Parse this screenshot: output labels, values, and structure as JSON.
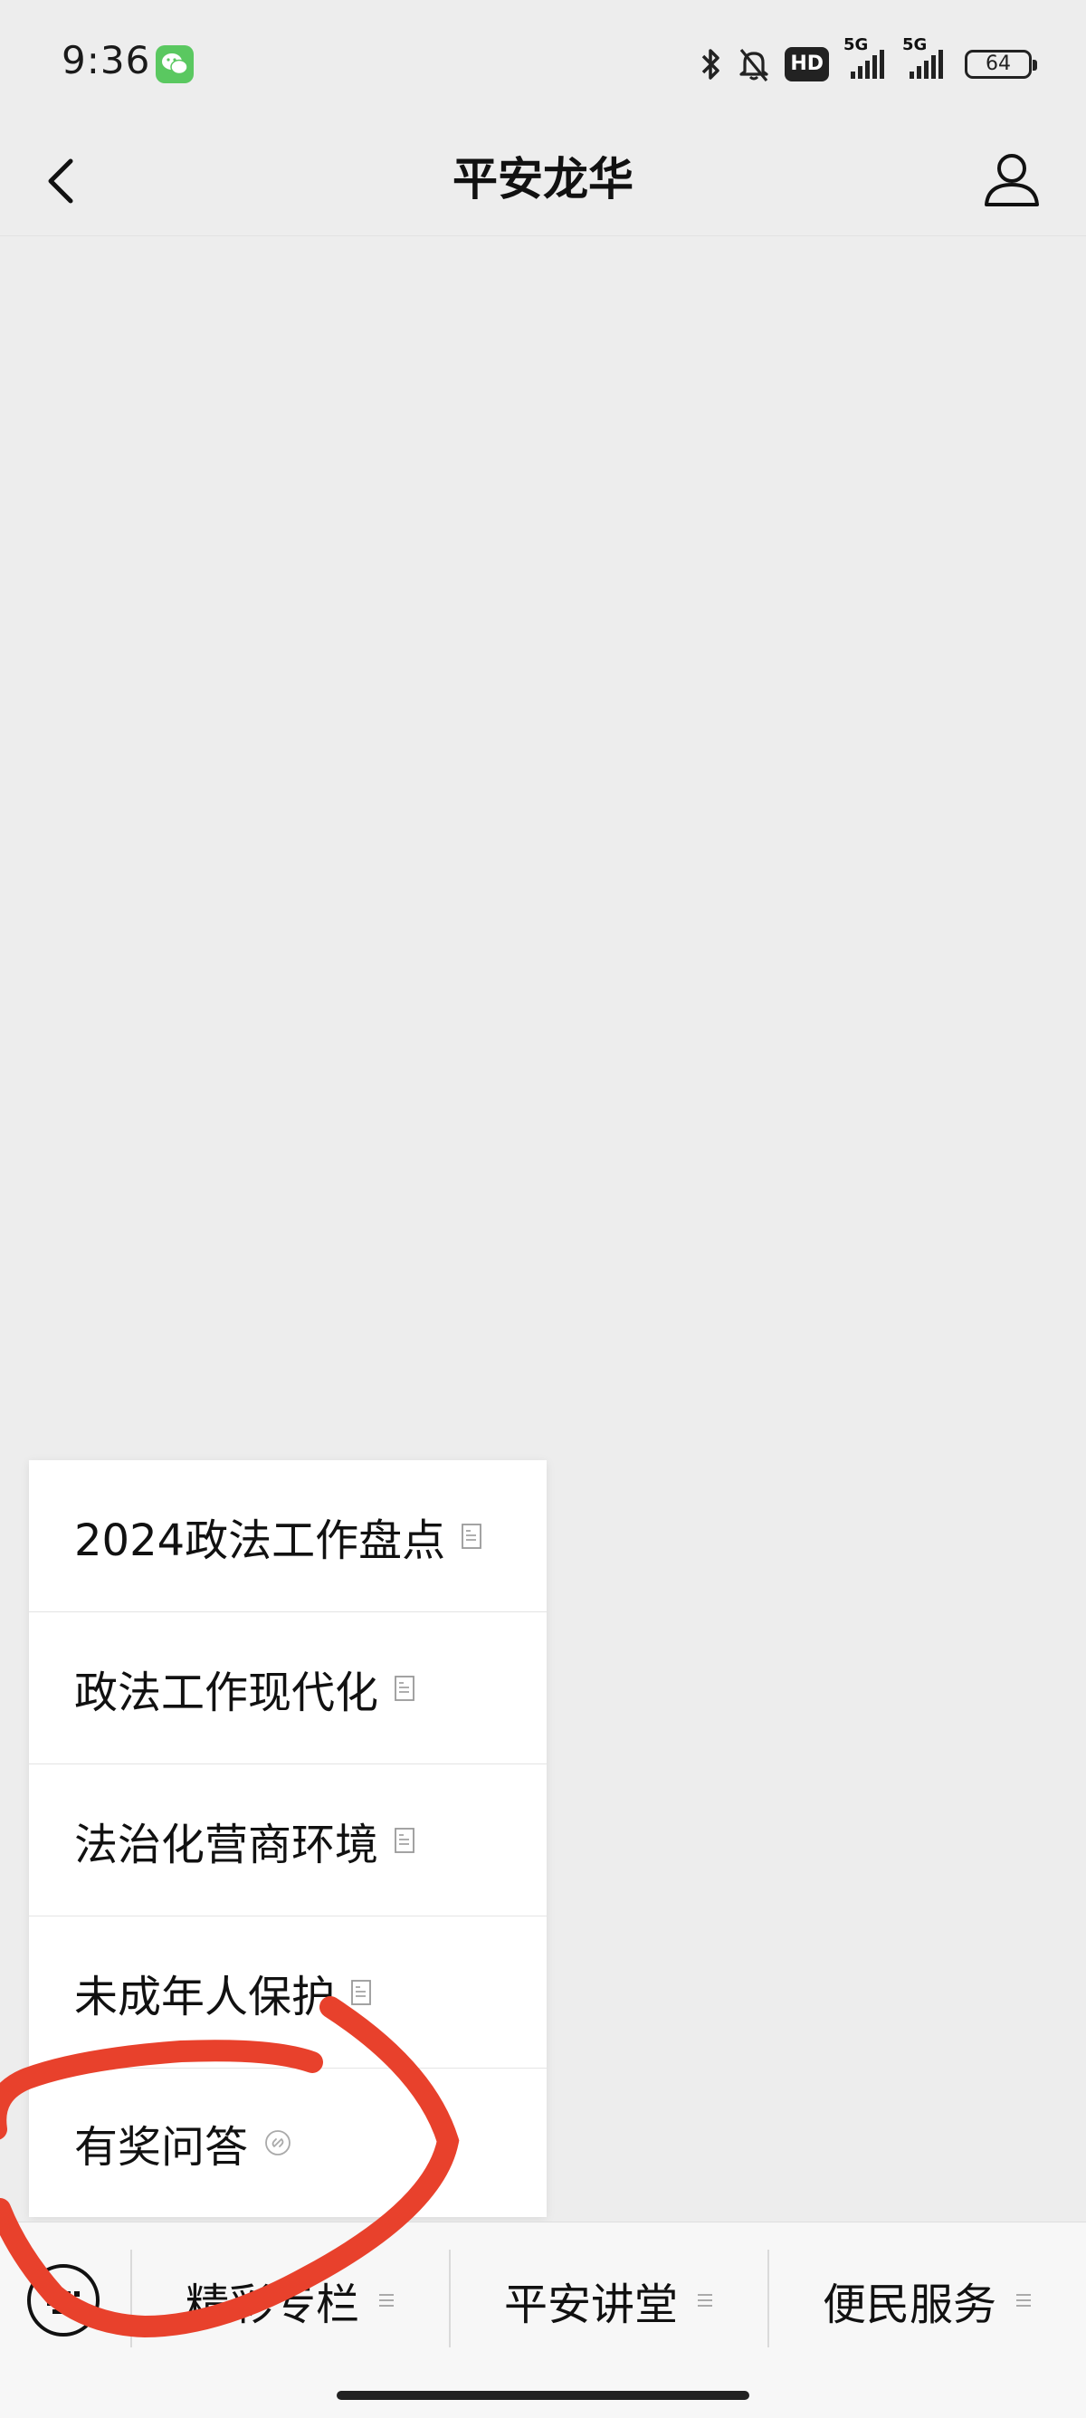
{
  "status_bar": {
    "time": "9:36",
    "network_badge": "HD",
    "network_1": "5G",
    "network_2": "5G",
    "battery": "64",
    "icons": [
      "wechat-icon",
      "bluetooth-icon",
      "mute-bell-icon",
      "hd-icon",
      "signal-icon",
      "signal-icon",
      "battery-icon"
    ]
  },
  "header": {
    "title": "平安龙华",
    "back_icon": "chevron-left-icon",
    "profile_icon": "user-icon"
  },
  "popup_menu": {
    "items": [
      {
        "label": "2024政法工作盘点",
        "icon": "document-icon"
      },
      {
        "label": "政法工作现代化",
        "icon": "document-icon"
      },
      {
        "label": "法治化营商环境",
        "icon": "document-icon"
      },
      {
        "label": "未成年人保护",
        "icon": "document-icon"
      },
      {
        "label": "有奖问答",
        "icon": "mini-program-link-icon"
      }
    ]
  },
  "bottom_menu": {
    "keyboard_icon": "keyboard-icon",
    "tabs": [
      {
        "label": "精彩专栏"
      },
      {
        "label": "平安讲堂"
      },
      {
        "label": "便民服务"
      }
    ]
  },
  "colors": {
    "background": "#ededed",
    "annotation": "#e8412c",
    "wechat_green": "#5ac860"
  }
}
